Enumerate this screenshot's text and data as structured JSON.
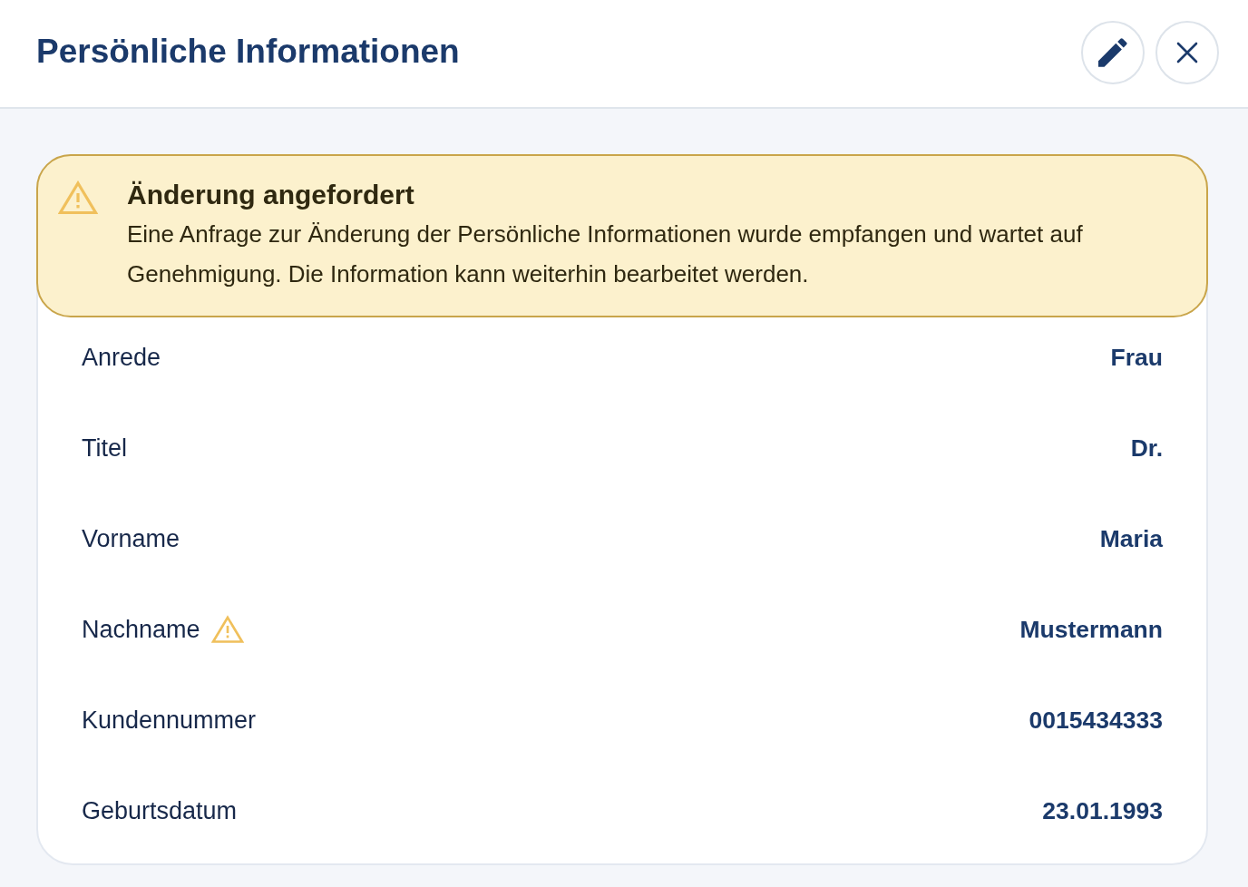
{
  "header": {
    "title": "Persönliche Informationen",
    "actions": [
      {
        "kind": "edit"
      },
      {
        "kind": "close"
      }
    ]
  },
  "alert": {
    "title": "Änderung angefordert",
    "message": "Eine Anfrage zur Änderung der Persönliche Informationen wurde empfangen und wartet auf Genehmigung. Die Information kann weiterhin bearbeitet werden."
  },
  "fields": [
    {
      "label": "Anrede",
      "value": "Frau",
      "pending": false
    },
    {
      "label": "Titel",
      "value": "Dr.",
      "pending": false
    },
    {
      "label": "Vorname",
      "value": "Maria",
      "pending": false
    },
    {
      "label": "Nachname",
      "value": "Mustermann",
      "pending": true
    },
    {
      "label": "Kundennummer",
      "value": "0015434333",
      "pending": false
    },
    {
      "label": "Geburtsdatum",
      "value": "23.01.1993",
      "pending": false
    }
  ]
}
